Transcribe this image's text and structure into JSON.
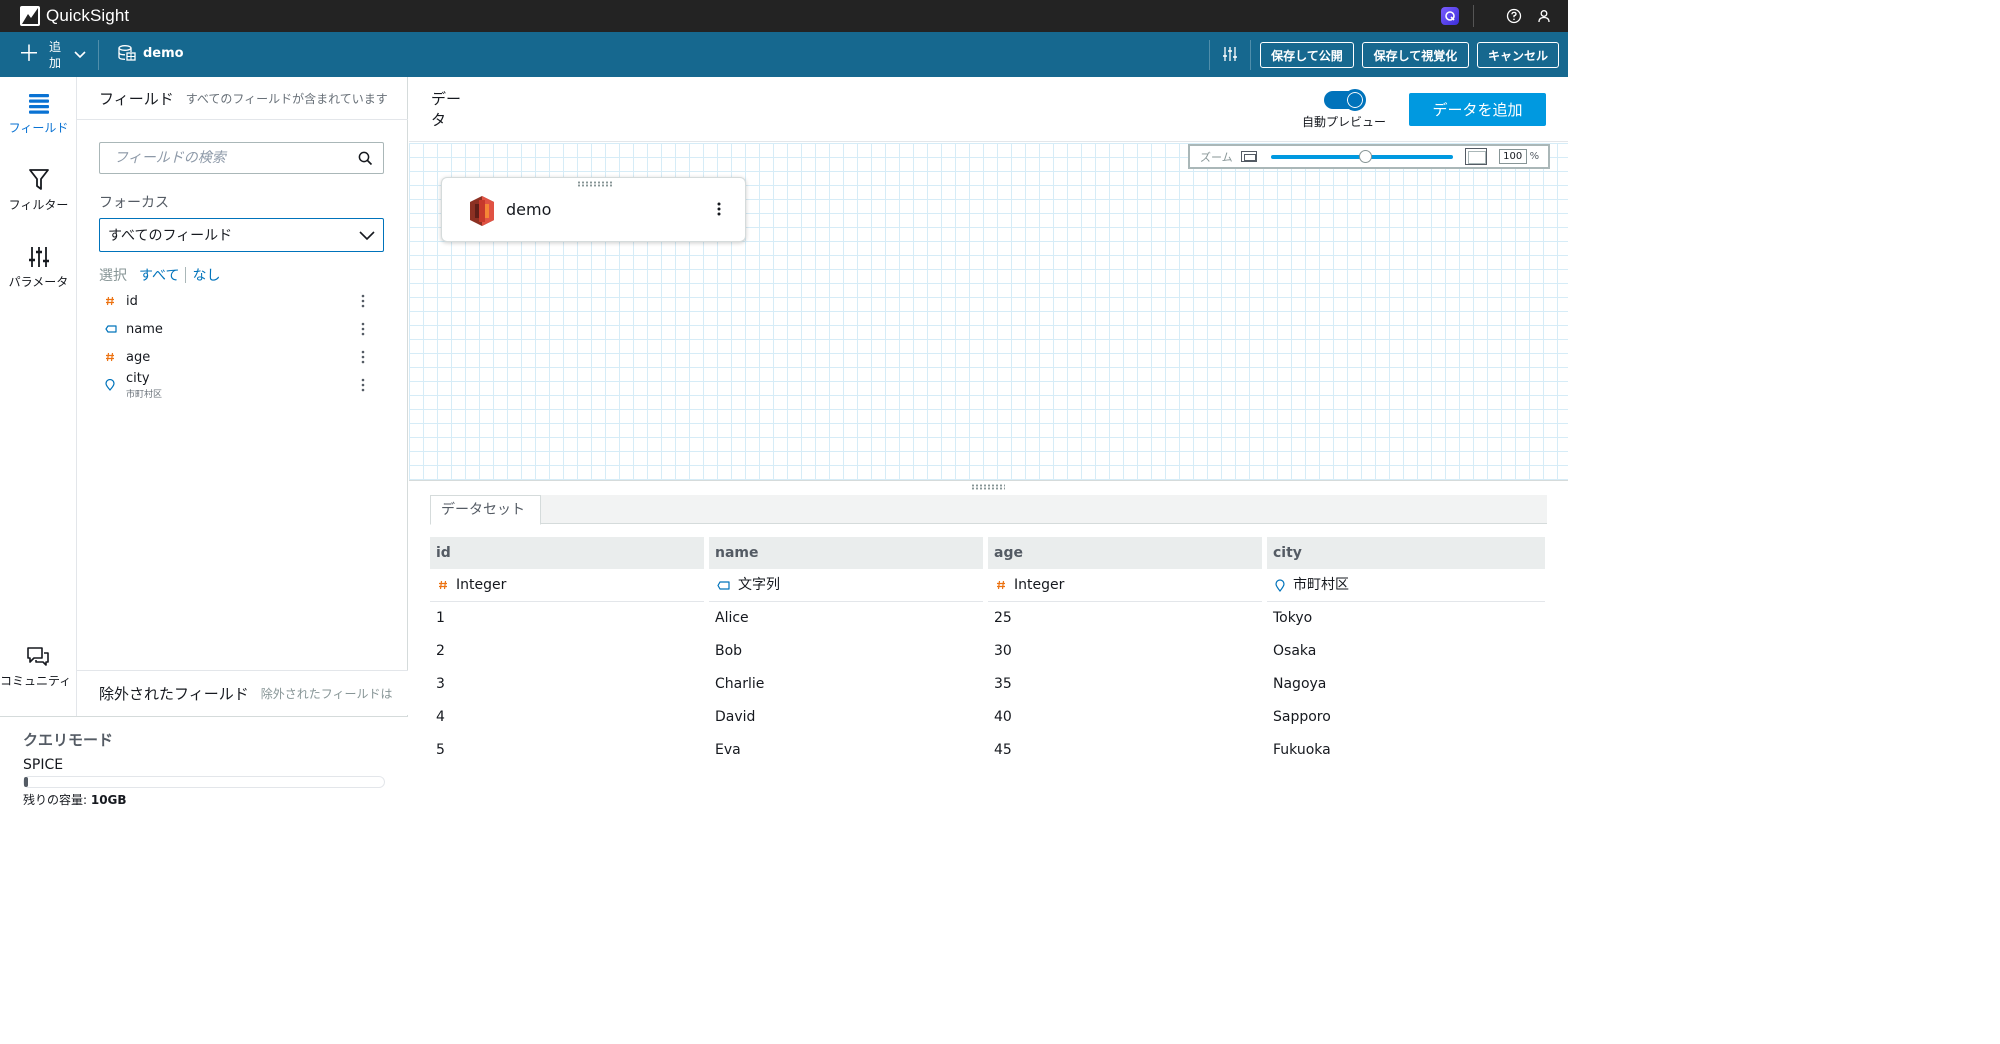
{
  "app": {
    "name": "QuickSight"
  },
  "toolbar": {
    "add_label": "追加",
    "dataset_name": "demo",
    "publish_button": "保存して公開",
    "visualize_button": "保存して視覚化",
    "cancel_button": "キャンセル"
  },
  "rail": {
    "items": [
      {
        "label": "フィールド",
        "icon": "fields-icon",
        "active": true
      },
      {
        "label": "フィルター",
        "icon": "filter-icon"
      },
      {
        "label": "パラメータ",
        "icon": "parameters-icon"
      },
      {
        "label": "コミュニティ",
        "icon": "community-icon"
      }
    ]
  },
  "fields_panel": {
    "title": "フィールド",
    "subtitle": "すべてのフィールドが含まれています",
    "search_placeholder": "フィールドの検索",
    "focus_label": "フォーカス",
    "focus_value": "すべてのフィールド",
    "select_label": "選択",
    "select_all": "すべて",
    "select_none": "なし",
    "fields": [
      {
        "name": "id",
        "type_icon": "number-icon"
      },
      {
        "name": "name",
        "type_icon": "string-icon"
      },
      {
        "name": "age",
        "type_icon": "number-icon"
      },
      {
        "name": "city",
        "type_icon": "location-icon",
        "sub": "市町村区"
      }
    ],
    "excluded_title": "除外されたフィールド",
    "excluded_sub": "除外されたフィールドは"
  },
  "query_mode": {
    "title": "クエリモード",
    "mode": "SPICE",
    "capacity_label": "残りの容量: ",
    "capacity_value": "10GB",
    "usage_fraction": 0.01
  },
  "canvas": {
    "title": "データ",
    "auto_preview_label": "自動プレビュー",
    "auto_preview_on": true,
    "add_data_button": "データを追加",
    "zoom_label": "ズーム",
    "zoom_value": "100",
    "zoom_unit": "%",
    "node_name": "demo",
    "node_icon": "s3-bucket-icon"
  },
  "dataset": {
    "tab_label": "データセット",
    "columns": [
      {
        "name": "id",
        "type": "Integer",
        "type_icon": "number-icon"
      },
      {
        "name": "name",
        "type": "文字列",
        "type_icon": "string-icon"
      },
      {
        "name": "age",
        "type": "Integer",
        "type_icon": "number-icon"
      },
      {
        "name": "city",
        "type": "市町村区",
        "type_icon": "location-icon"
      }
    ],
    "rows": [
      [
        "1",
        "Alice",
        "25",
        "Tokyo"
      ],
      [
        "2",
        "Bob",
        "30",
        "Osaka"
      ],
      [
        "3",
        "Charlie",
        "35",
        "Nagoya"
      ],
      [
        "4",
        "David",
        "40",
        "Sapporo"
      ],
      [
        "5",
        "Eva",
        "45",
        "Fukuoka"
      ]
    ]
  },
  "colors": {
    "topbar": "#232323",
    "toolbar": "#16688f",
    "accent": "#0073bb",
    "number_icon": "#ec7211",
    "string_icon": "#0073bb"
  }
}
